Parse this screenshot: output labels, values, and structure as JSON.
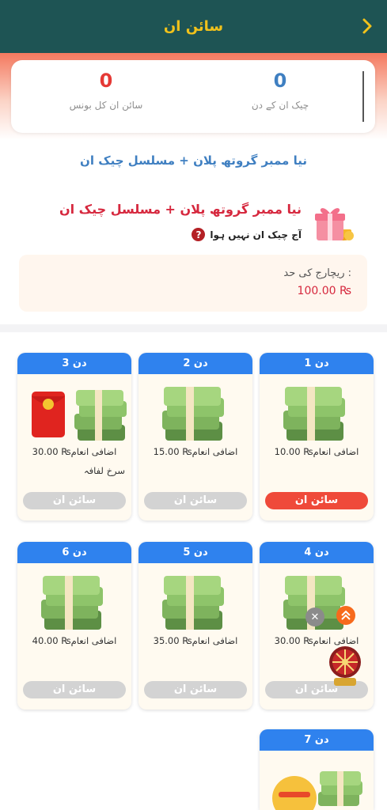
{
  "header": {
    "title": "سائن ان"
  },
  "stats": {
    "checkin_days_value": "0",
    "checkin_days_label": "چیک ان کے دن",
    "total_bonus_value": "0",
    "total_bonus_label": "سائن ان کل بونس",
    "value_color": "#e53935",
    "days_color": "#3f7fc1"
  },
  "plan": {
    "heading": "نیا ممبر گروتھ پلان + مسلسل چیک ان",
    "title": "نیا ممبر گروتھ پلان + مسلسل چیک ان",
    "status": "آج چیک ان نہیں ہوا",
    "status_icon": "?"
  },
  "recharge": {
    "label": "ریچارج کی حد :",
    "value": "100.00 ₨"
  },
  "days": [
    {
      "day": "دن 1",
      "reward": "اضافی انعام₨ 10.00",
      "extra": "",
      "button": "سائن ان",
      "active": true
    },
    {
      "day": "دن 2",
      "reward": "اضافی انعام₨ 15.00",
      "extra": "",
      "button": "سائن ان",
      "active": false
    },
    {
      "day": "دن 3",
      "reward": "اضافی انعام₨ 30.00",
      "extra": "سرخ لفافہ",
      "button": "سائن ان",
      "active": false
    },
    {
      "day": "دن 4",
      "reward": "اضافی انعام₨ 30.00",
      "extra": "",
      "button": "سائن ان",
      "active": false
    },
    {
      "day": "دن 5",
      "reward": "اضافی انعام₨ 35.00",
      "extra": "",
      "button": "سائن ان",
      "active": false
    },
    {
      "day": "دن 6",
      "reward": "اضافی انعام₨ 40.00",
      "extra": "",
      "button": "سائن ان",
      "active": false
    },
    {
      "day": "دن 7",
      "reward": "",
      "extra": "",
      "button": "",
      "active": false
    }
  ],
  "colors": {
    "header_bg": "#1e5454",
    "header_title": "#f1c21b",
    "day_header": "#2f82ee",
    "button_active": "#ef4a3a",
    "button_disabled": "#d3d3d3"
  },
  "icons": {
    "back": "chevron-right-icon",
    "gift": "gift-icon",
    "money": "money-stack-icon",
    "red_envelope": "red-envelope-icon",
    "help": "question-icon"
  }
}
